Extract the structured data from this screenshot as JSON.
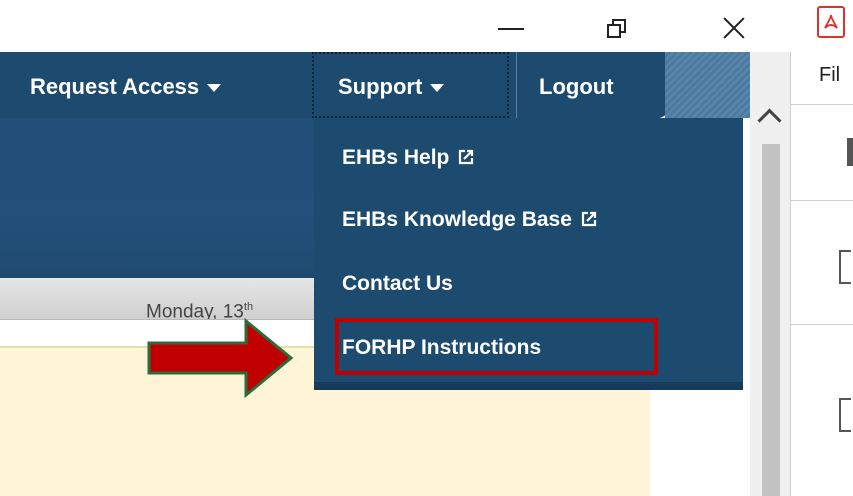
{
  "window_controls": {
    "minimize_icon": "minimize-icon",
    "restore_icon": "restore-icon",
    "close_icon": "close-icon",
    "pdf_icon": "pdf-icon"
  },
  "nav": {
    "request_access": "Request Access",
    "support": "Support",
    "logout": "Logout"
  },
  "dropdown": {
    "items": [
      {
        "label": "EHBs Help",
        "external": true
      },
      {
        "label": "EHBs Knowledge Base",
        "external": true
      },
      {
        "label": "Contact Us",
        "external": false
      },
      {
        "label": "FORHP Instructions",
        "external": false
      }
    ]
  },
  "date": {
    "text": "Monday, 13",
    "suffix": "th"
  },
  "right_panel": {
    "file_label": "Fil"
  },
  "colors": {
    "nav_bg": "#1d4b70",
    "content_bg": "#fdf5d6",
    "highlight": "#c00000",
    "arrow_fill": "#c00000",
    "arrow_border": "#2e6b3a"
  }
}
